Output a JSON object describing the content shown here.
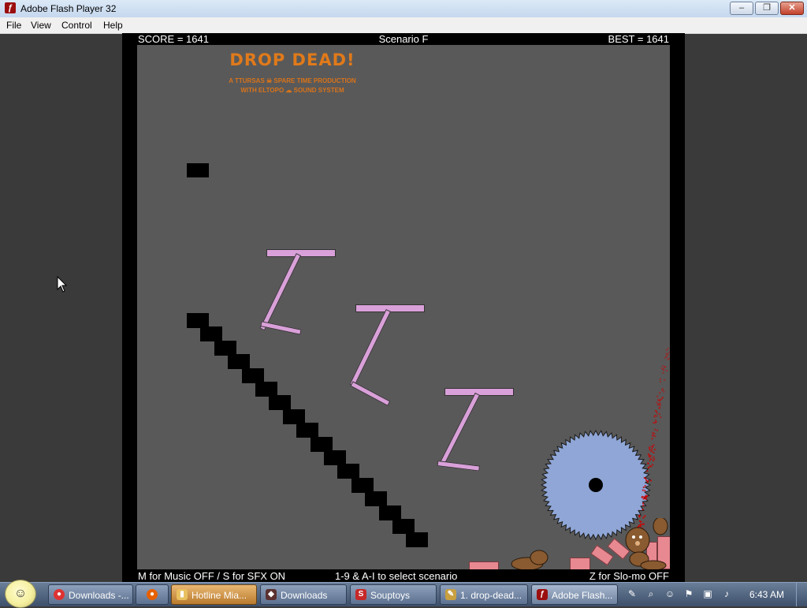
{
  "window": {
    "title": "Adobe Flash Player 32",
    "app_icon": "flash-icon",
    "buttons": {
      "minimize": "–",
      "maximize": "❐",
      "close": "✕"
    }
  },
  "menu": [
    "File",
    "View",
    "Control",
    "Help"
  ],
  "game": {
    "score": "SCORE = 1641",
    "scenario": "Scenario F",
    "best": "BEST = 1641",
    "logo": "DROP DEAD!",
    "credit_1": "A TTURSAS ☠ SPARE TIME PRODUCTION",
    "credit_2": "WITH ELTOPO ☁ SOUND SYSTEM",
    "hint_left": "M for Music OFF / S for SFX ON",
    "hint_center": "1-9 & A-I to select scenario",
    "hint_right": "Z for Slo-mo OFF",
    "colors": {
      "background": "#595959",
      "platform": "#d9a0d9",
      "saw": "#8fa6d6",
      "brick": "#e88890",
      "blood": "#cc0000"
    }
  },
  "taskbar": {
    "start_icon": "smiley-start-icon",
    "items": [
      {
        "label": "Downloads -...",
        "icon": "chrome-icon"
      },
      {
        "label": "",
        "icon": "firefox-icon"
      },
      {
        "label": "Hotline Mia...",
        "icon": "folder-icon"
      },
      {
        "label": "Downloads",
        "icon": "browser-icon"
      },
      {
        "label": "Souptoys",
        "icon": "souptoys-icon"
      },
      {
        "label": "1. drop-dead...",
        "icon": "pencil-icon"
      },
      {
        "label": "Adobe Flash...",
        "icon": "flash-icon"
      }
    ],
    "clock": "6:43 AM"
  }
}
